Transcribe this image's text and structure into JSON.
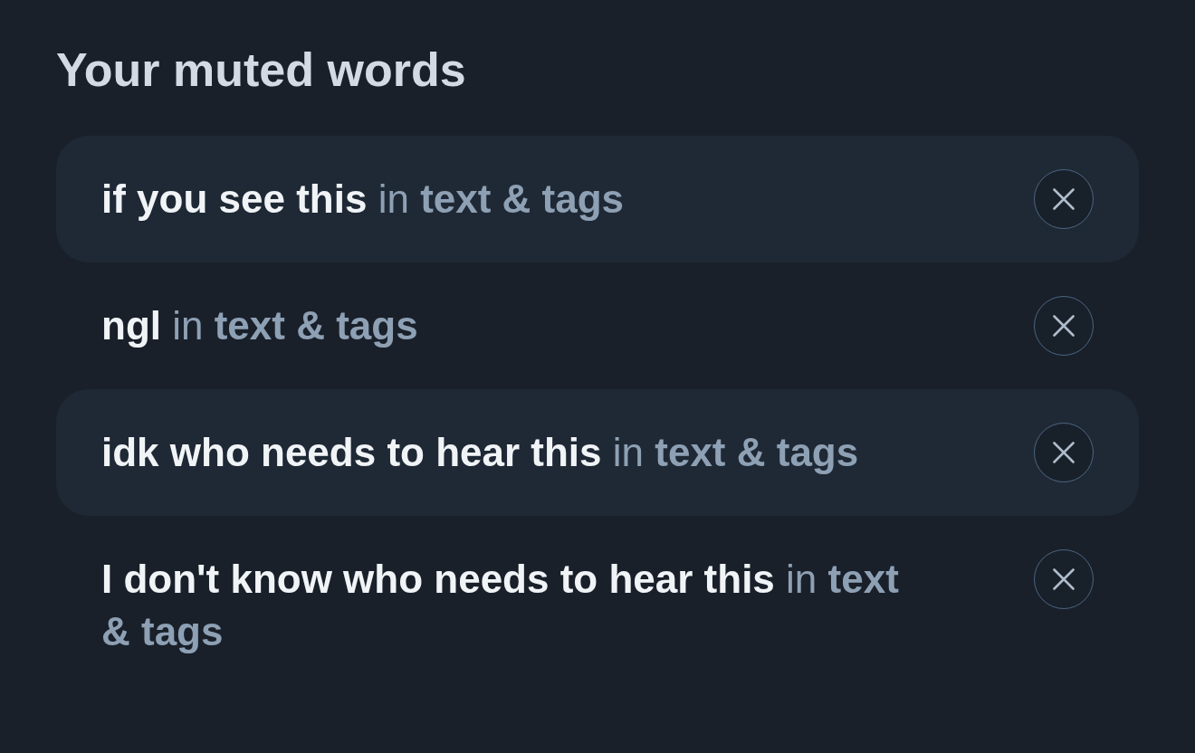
{
  "title": "Your muted words",
  "muted_words": [
    {
      "word": "if you see this",
      "scope": "in **text & tags**"
    },
    {
      "word": "ngl",
      "scope": "in **text & tags**"
    },
    {
      "word": "idk who needs to hear this",
      "scope": "in **text & tags**"
    },
    {
      "word": "I don't know who needs to hear this",
      "scope": "in **text & tags**"
    }
  ]
}
